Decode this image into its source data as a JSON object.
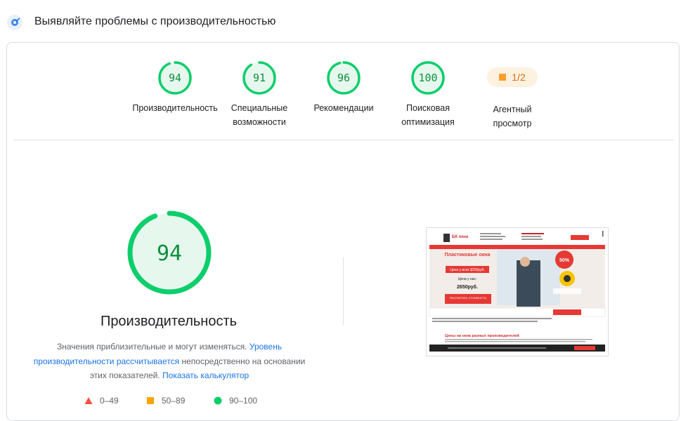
{
  "header": {
    "title": "Выявляйте проблемы с производительностью",
    "icon": "lighthouse-icon"
  },
  "colors": {
    "pass": "#0cce6b",
    "pass_text": "#0d8f3c",
    "pass_bg": "#e6f8ee",
    "average": "#ffa400",
    "fail": "#ff4e42",
    "link": "#1a73e8"
  },
  "categories": [
    {
      "label_line1": "Производительность",
      "label_line2": "",
      "score": 94
    },
    {
      "label_line1": "Специальные",
      "label_line2": "возможности",
      "score": 91
    },
    {
      "label_line1": "Рекомендации",
      "label_line2": "",
      "score": 96
    },
    {
      "label_line1": "Поисковая",
      "label_line2": "оптимизация",
      "score": 100
    }
  ],
  "pwa": {
    "label_line1": "Агентный",
    "label_line2": "просмотр",
    "value": "1/2"
  },
  "main": {
    "score": 94,
    "title": "Производительность",
    "desc_part1": "Значения приблизительные и могут изменяться. ",
    "desc_link1": "Уровень производительности рассчитывается",
    "desc_part2": " непосредственно на основании этих показателей. ",
    "desc_link2": "Показать калькулятор"
  },
  "legend": [
    {
      "shape": "triangle",
      "range": "0–49"
    },
    {
      "shape": "square",
      "range": "50–89"
    },
    {
      "shape": "circle",
      "range": "90–100"
    }
  ],
  "screenshot": {
    "logo": "БК окна",
    "hero_title": "Пластиковые окна",
    "badge": "50%",
    "price_old": "Цена у всех $250руб.",
    "price_label": "Цена у нас:",
    "price": "2650руб.",
    "cta": "РАССЧИТАТЬ СТОИМОСТЬ",
    "section_title": "Цены на окна разных производителей"
  }
}
